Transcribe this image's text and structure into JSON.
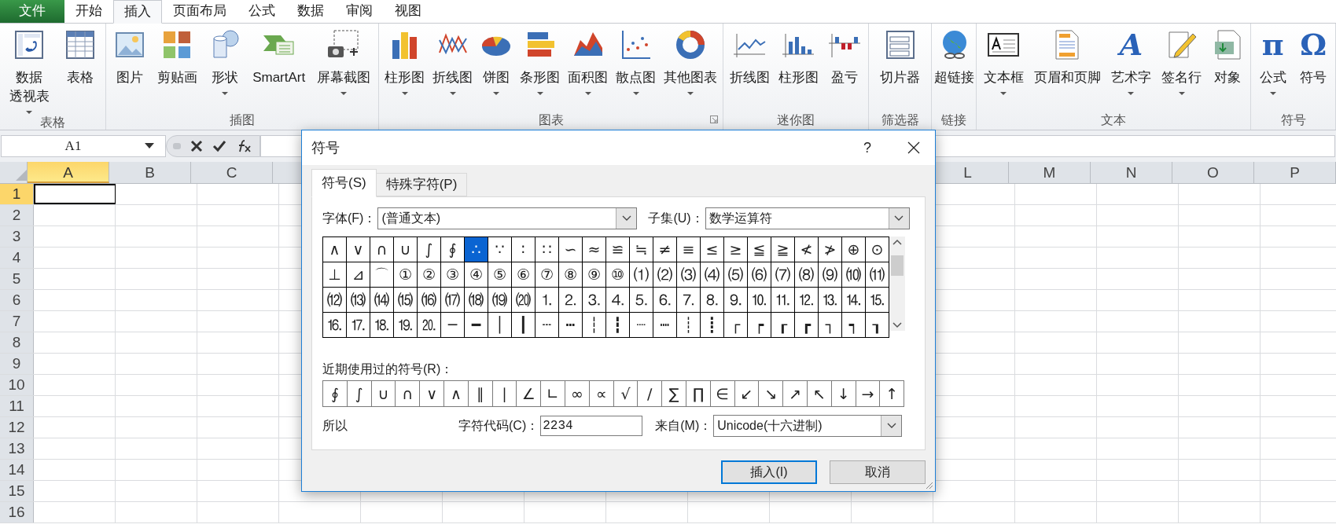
{
  "app_tabs": [
    {
      "label": "文件",
      "kind": "file",
      "selected": false
    },
    {
      "label": "开始",
      "kind": "tab",
      "selected": false
    },
    {
      "label": "插入",
      "kind": "tab",
      "selected": true
    },
    {
      "label": "页面布局",
      "kind": "tab",
      "selected": false
    },
    {
      "label": "公式",
      "kind": "tab",
      "selected": false
    },
    {
      "label": "数据",
      "kind": "tab",
      "selected": false
    },
    {
      "label": "审阅",
      "kind": "tab",
      "selected": false
    },
    {
      "label": "视图",
      "kind": "tab",
      "selected": false
    }
  ],
  "ribbon_groups": [
    {
      "label": "表格",
      "launcher": false,
      "buttons": [
        {
          "label_lines": [
            "数据",
            "透视表"
          ],
          "dropdown": true
        },
        {
          "label": "表格",
          "dropdown": false
        }
      ]
    },
    {
      "label": "插图",
      "launcher": false,
      "buttons": [
        {
          "label": "图片",
          "dropdown": false
        },
        {
          "label": "剪贴画",
          "dropdown": false
        },
        {
          "label": "形状",
          "dropdown": true
        },
        {
          "label": "SmartArt",
          "dropdown": false
        },
        {
          "label": "屏幕截图",
          "dropdown": true
        }
      ]
    },
    {
      "label": "图表",
      "launcher": true,
      "buttons": [
        {
          "label": "柱形图",
          "dropdown": true
        },
        {
          "label": "折线图",
          "dropdown": true
        },
        {
          "label": "饼图",
          "dropdown": true
        },
        {
          "label": "条形图",
          "dropdown": true
        },
        {
          "label": "面积图",
          "dropdown": true
        },
        {
          "label": "散点图",
          "dropdown": true
        },
        {
          "label": "其他图表",
          "dropdown": true
        }
      ]
    },
    {
      "label": "迷你图",
      "launcher": false,
      "buttons": [
        {
          "label": "折线图",
          "dropdown": false
        },
        {
          "label": "柱形图",
          "dropdown": false
        },
        {
          "label": "盈亏",
          "dropdown": false
        }
      ]
    },
    {
      "label": "筛选器",
      "launcher": false,
      "buttons": [
        {
          "label": "切片器",
          "dropdown": false
        }
      ]
    },
    {
      "label": "链接",
      "launcher": false,
      "buttons": [
        {
          "label": "超链接",
          "dropdown": false
        }
      ]
    },
    {
      "label": "文本",
      "launcher": false,
      "buttons": [
        {
          "label": "文本框",
          "dropdown": true
        },
        {
          "label": "页眉和页脚",
          "dropdown": false
        },
        {
          "label": "艺术字",
          "dropdown": true,
          "glyph": "A"
        },
        {
          "label": "签名行",
          "dropdown": true
        },
        {
          "label": "对象",
          "dropdown": false
        }
      ]
    },
    {
      "label": "符号",
      "launcher": false,
      "buttons": [
        {
          "label": "公式",
          "dropdown": true,
          "glyph": "π"
        },
        {
          "label": "符号",
          "dropdown": false,
          "glyph": "Ω"
        }
      ]
    }
  ],
  "formula_bar": {
    "name_box": "A1"
  },
  "sheet": {
    "columns_left": [
      {
        "label": "A",
        "selected": true
      },
      {
        "label": "B",
        "selected": false
      },
      {
        "label": "C",
        "selected": false
      }
    ],
    "columns_right": [
      {
        "label": "L",
        "selected": false
      },
      {
        "label": "M",
        "selected": false
      },
      {
        "label": "N",
        "selected": false
      },
      {
        "label": "O",
        "selected": false
      },
      {
        "label": "P",
        "selected": false
      }
    ],
    "rows": [
      {
        "label": "1",
        "selected": true
      },
      {
        "label": "2",
        "selected": false
      },
      {
        "label": "3",
        "selected": false
      },
      {
        "label": "4",
        "selected": false
      },
      {
        "label": "5",
        "selected": false
      },
      {
        "label": "6",
        "selected": false
      },
      {
        "label": "7",
        "selected": false
      },
      {
        "label": "8",
        "selected": false
      },
      {
        "label": "9",
        "selected": false
      },
      {
        "label": "10",
        "selected": false
      },
      {
        "label": "11",
        "selected": false
      },
      {
        "label": "12",
        "selected": false
      },
      {
        "label": "13",
        "selected": false
      },
      {
        "label": "14",
        "selected": false
      },
      {
        "label": "15",
        "selected": false
      },
      {
        "label": "16",
        "selected": false
      }
    ]
  },
  "dialog": {
    "title": "符号",
    "help": "?",
    "tabs": [
      {
        "label": "符号(S)",
        "selected": true
      },
      {
        "label": "特殊字符(P)",
        "selected": false
      }
    ],
    "font": {
      "label": "字体(F)：",
      "value": "(普通文本)"
    },
    "subset": {
      "label": "子集(U)：",
      "value": "数学运算符"
    },
    "symbol_rows": [
      [
        {
          "char": "∧",
          "selected": false
        },
        {
          "char": "∨",
          "selected": false
        },
        {
          "char": "∩",
          "selected": false
        },
        {
          "char": "∪",
          "selected": false
        },
        {
          "char": "∫",
          "selected": false
        },
        {
          "char": "∮",
          "selected": false
        },
        {
          "char": "∴",
          "selected": true
        },
        {
          "char": "∵",
          "selected": false
        },
        {
          "char": "∶",
          "selected": false
        },
        {
          "char": "∷",
          "selected": false
        },
        {
          "char": "∽",
          "selected": false
        },
        {
          "char": "≈",
          "selected": false
        },
        {
          "char": "≌",
          "selected": false
        },
        {
          "char": "≒",
          "selected": false
        },
        {
          "char": "≠",
          "selected": false
        },
        {
          "char": "≡",
          "selected": false
        },
        {
          "char": "≤",
          "selected": false
        },
        {
          "char": "≥",
          "selected": false
        },
        {
          "char": "≦",
          "selected": false
        },
        {
          "char": "≧",
          "selected": false
        },
        {
          "char": "≮",
          "selected": false
        },
        {
          "char": "≯",
          "selected": false
        },
        {
          "char": "⊕",
          "selected": false
        },
        {
          "char": "⊙",
          "selected": false
        }
      ],
      [
        {
          "char": "⊥",
          "selected": false
        },
        {
          "char": "⊿",
          "selected": false
        },
        {
          "char": "⌒",
          "selected": false
        },
        {
          "char": "①",
          "selected": false
        },
        {
          "char": "②",
          "selected": false
        },
        {
          "char": "③",
          "selected": false
        },
        {
          "char": "④",
          "selected": false
        },
        {
          "char": "⑤",
          "selected": false
        },
        {
          "char": "⑥",
          "selected": false
        },
        {
          "char": "⑦",
          "selected": false
        },
        {
          "char": "⑧",
          "selected": false
        },
        {
          "char": "⑨",
          "selected": false
        },
        {
          "char": "⑩",
          "selected": false
        },
        {
          "char": "⑴",
          "selected": false
        },
        {
          "char": "⑵",
          "selected": false
        },
        {
          "char": "⑶",
          "selected": false
        },
        {
          "char": "⑷",
          "selected": false
        },
        {
          "char": "⑸",
          "selected": false
        },
        {
          "char": "⑹",
          "selected": false
        },
        {
          "char": "⑺",
          "selected": false
        },
        {
          "char": "⑻",
          "selected": false
        },
        {
          "char": "⑼",
          "selected": false
        },
        {
          "char": "⑽",
          "selected": false
        },
        {
          "char": "⑾",
          "selected": false
        }
      ],
      [
        {
          "char": "⑿",
          "selected": false
        },
        {
          "char": "⒀",
          "selected": false
        },
        {
          "char": "⒁",
          "selected": false
        },
        {
          "char": "⒂",
          "selected": false
        },
        {
          "char": "⒃",
          "selected": false
        },
        {
          "char": "⒄",
          "selected": false
        },
        {
          "char": "⒅",
          "selected": false
        },
        {
          "char": "⒆",
          "selected": false
        },
        {
          "char": "⒇",
          "selected": false
        },
        {
          "char": "⒈",
          "selected": false
        },
        {
          "char": "⒉",
          "selected": false
        },
        {
          "char": "⒊",
          "selected": false
        },
        {
          "char": "⒋",
          "selected": false
        },
        {
          "char": "⒌",
          "selected": false
        },
        {
          "char": "⒍",
          "selected": false
        },
        {
          "char": "⒎",
          "selected": false
        },
        {
          "char": "⒏",
          "selected": false
        },
        {
          "char": "⒐",
          "selected": false
        },
        {
          "char": "⒑",
          "selected": false
        },
        {
          "char": "⒒",
          "selected": false
        },
        {
          "char": "⒓",
          "selected": false
        },
        {
          "char": "⒔",
          "selected": false
        },
        {
          "char": "⒕",
          "selected": false
        },
        {
          "char": "⒖",
          "selected": false
        }
      ],
      [
        {
          "char": "⒗",
          "selected": false
        },
        {
          "char": "⒘",
          "selected": false
        },
        {
          "char": "⒙",
          "selected": false
        },
        {
          "char": "⒚",
          "selected": false
        },
        {
          "char": "⒛",
          "selected": false
        },
        {
          "char": "─",
          "selected": false
        },
        {
          "char": "━",
          "selected": false
        },
        {
          "char": "│",
          "selected": false
        },
        {
          "char": "┃",
          "selected": false
        },
        {
          "char": "┄",
          "selected": false
        },
        {
          "char": "┅",
          "selected": false
        },
        {
          "char": "┆",
          "selected": false
        },
        {
          "char": "┇",
          "selected": false
        },
        {
          "char": "┈",
          "selected": false
        },
        {
          "char": "┉",
          "selected": false
        },
        {
          "char": "┊",
          "selected": false
        },
        {
          "char": "┋",
          "selected": false
        },
        {
          "char": "┌",
          "selected": false
        },
        {
          "char": "┍",
          "selected": false
        },
        {
          "char": "┎",
          "selected": false
        },
        {
          "char": "┏",
          "selected": false
        },
        {
          "char": "┐",
          "selected": false
        },
        {
          "char": "┑",
          "selected": false
        },
        {
          "char": "┒",
          "selected": false
        }
      ]
    ],
    "recent_label": "近期使用过的符号(R)：",
    "recent": [
      "∮",
      "∫",
      "∪",
      "∩",
      "∨",
      "∧",
      "∥",
      "∣",
      "∠",
      "∟",
      "∞",
      "∝",
      "√",
      "∕",
      "∑",
      "∏",
      "∈",
      "↙",
      "↘",
      "↗",
      "↖",
      "↓",
      "→",
      "↑"
    ],
    "char_name": "所以",
    "code_label": "字符代码(C)：",
    "code_value": "2234",
    "from_label": "来自(M)：",
    "from_value": "Unicode(十六进制)",
    "buttons": [
      {
        "label": "插入(I)",
        "default": true
      },
      {
        "label": "取消",
        "default": false
      }
    ]
  }
}
